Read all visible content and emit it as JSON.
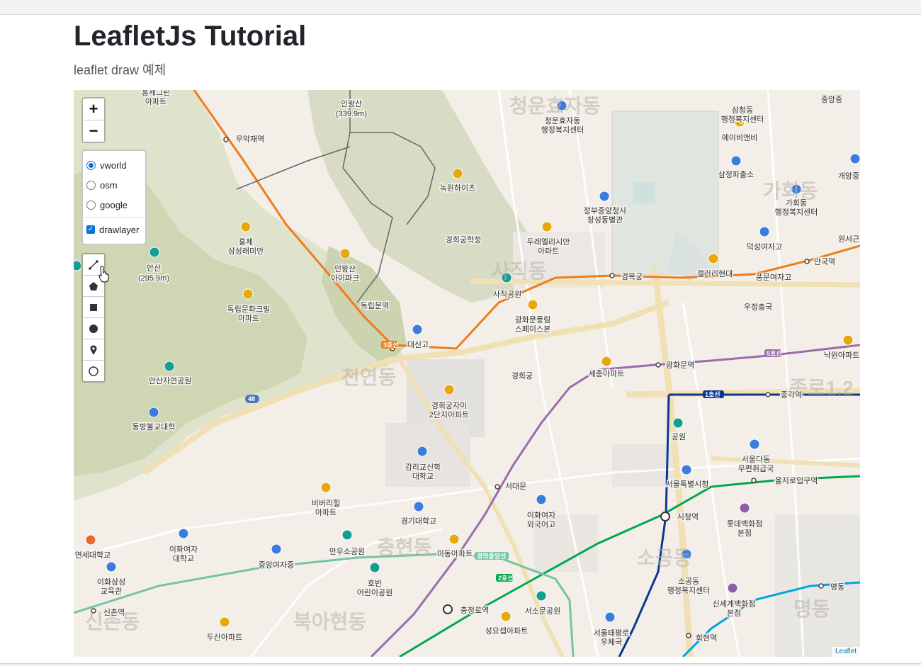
{
  "page": {
    "title": "LeafletJs Tutorial",
    "subtitle": "leaflet draw 예제"
  },
  "map": {
    "zoom_in": "+",
    "zoom_out": "−",
    "layers": [
      {
        "label": "vworld",
        "selected": true
      },
      {
        "label": "osm",
        "selected": false
      },
      {
        "label": "google",
        "selected": false
      }
    ],
    "overlay": {
      "label": "drawlayer",
      "checked": true
    },
    "draw_tools": [
      "polyline",
      "polygon",
      "rectangle",
      "circle",
      "marker",
      "circlemarker"
    ],
    "attribution": "Leaflet",
    "labels": {
      "lbl_0": "홍제그린\n아파트",
      "lbl_1": "인왕산",
      "lbl_2": "(339.9m)",
      "lbl_3": "청운효자동",
      "lbl_4": "청운효자동\n행정복지센터",
      "lbl_5": "삼청동\n행정복지센터",
      "lbl_6": "중앙중",
      "lbl_7": "무악재역",
      "lbl_8": "에이비앤비",
      "lbl_9": "녹원하이츠",
      "lbl_10": "삼정파출소",
      "lbl_11": "개앙중",
      "lbl_12": "가회동",
      "lbl_13": "정부중앙청사\n창성동별관",
      "lbl_14": "가회동\n행정복지센터",
      "lbl_15": "경희궁학정",
      "lbl_16": "두레엘리시안\n아파트",
      "lbl_17": "원서근",
      "lbl_18": "덕성여자고",
      "lbl_19": "홍제\n삼성래미안",
      "lbl_20": "안산",
      "lbl_21": "(295.9m)",
      "lbl_22": "인왕산\n아이파크",
      "lbl_23": "갤러리현대",
      "lbl_24": "안국역",
      "lbl_25": "풍문여자고",
      "lbl_26": "경복궁",
      "lbl_27": "사직공원",
      "lbl_28": "독립문역",
      "lbl_29": "독립문파크빌\n아파트",
      "lbl_30": "광화문풍림\n스페이스본",
      "lbl_31": "우정총국",
      "lbl_32": "대신고",
      "lbl_33": "광화문역",
      "lbl_34": "낙원아파트",
      "lbl_35": "천연동",
      "lbl_36": "경희궁",
      "lbl_37": "세종아파트",
      "lbl_38": "안산자연공원",
      "lbl_39": "종각역",
      "lbl_40": "경희궁자이\n2단지아파트",
      "lbl_41": "동방불교대학",
      "lbl_42": "공원",
      "lbl_43": "감리교신학\n대학교",
      "lbl_44": "서울다동\n우편취급국",
      "lbl_45": "서울특별시청",
      "lbl_46": "을지로입구역",
      "lbl_47": "서대문",
      "lbl_48": "비버리힐\n아파트",
      "lbl_49": "이화여자\n외국어고",
      "lbl_50": "경기대학교",
      "lbl_51": "시청역",
      "lbl_52": "롯데백화점\n본점",
      "lbl_53": "연세대학교",
      "lbl_54": "이화여자\n대학교",
      "lbl_55": "만우소공원",
      "lbl_56": "미동아파트",
      "lbl_57": "충정로",
      "lbl_58": "중앙여자중",
      "lbl_59": "소공동",
      "lbl_60": "소공동\n행정복지센터",
      "lbl_61": "이화삼성\n교육관",
      "lbl_62": "호반\n어린이공원",
      "lbl_63": "명동",
      "lbl_64": "신촌역",
      "lbl_65": "충정로역",
      "lbl_66": "서소문공원",
      "lbl_67": "신세계백화점\n본점",
      "lbl_68": "명동",
      "lbl_69": "신촌동",
      "lbl_70": "북아현동",
      "lbl_71": "성요셉아파트",
      "lbl_72": "서울태평로\n우체국",
      "lbl_73": "두산아파트",
      "lbl_74": "회현역",
      "lbl_75": "사직동",
      "lbl_76": "종로1.2",
      "lbl_77": "충현동",
      "lbl_78": "1호선",
      "lbl_79": "5호선",
      "lbl_80": "2호선",
      "lbl_81": "3호선",
      "lbl_82": "경의중앙선",
      "lbl_83": "48"
    }
  }
}
